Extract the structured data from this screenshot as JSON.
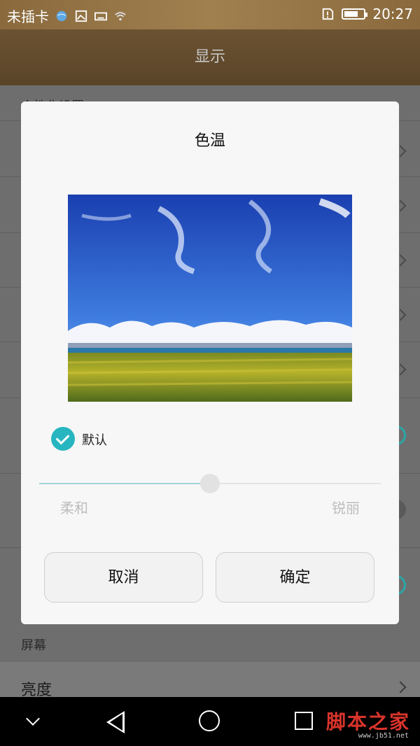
{
  "status_bar": {
    "carrier": "未插卡",
    "time": "20:27",
    "battery_level": 0.7
  },
  "app_bar": {
    "title": "显示"
  },
  "settings": {
    "section_personalization": "个性化设置",
    "section_screen": "屏幕",
    "brightness_label": "亮度"
  },
  "dialog": {
    "title": "色温",
    "default_label": "默认",
    "default_checked": true,
    "slider_value": 0.5,
    "soft_label": "柔和",
    "sharp_label": "锐丽",
    "cancel_label": "取消",
    "ok_label": "确定"
  },
  "watermark": {
    "text": "脚本之家",
    "sub": "www.jb51.net"
  },
  "colors": {
    "accent": "#27b6c0",
    "header": "#6b5232"
  }
}
